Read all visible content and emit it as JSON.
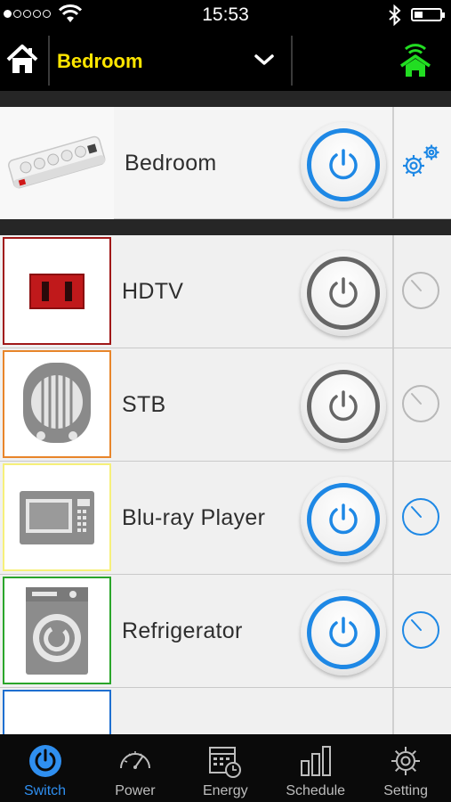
{
  "status_bar": {
    "time": "15:53",
    "signal_dots_on": 1,
    "signal_dots_total": 5,
    "icons": [
      "wifi-icon",
      "bluetooth-icon",
      "battery-icon"
    ],
    "battery_level": 0.35
  },
  "header": {
    "room": "Bedroom",
    "icons": [
      "home-icon",
      "chevron-down-icon",
      "connection-status-icon"
    ],
    "title_color": "#ffe600",
    "connection_color": "#22dd22"
  },
  "master": {
    "label": "Bedroom",
    "state": "on",
    "image": "power-strip",
    "side_icon": "settings-gears-icon"
  },
  "devices": [
    {
      "label": "HDTV",
      "state": "off",
      "frame_color": "#a01818",
      "image": "outlet-icon",
      "timer_active": false
    },
    {
      "label": "STB",
      "state": "off",
      "frame_color": "#e8852a",
      "image": "heater-icon",
      "timer_active": false
    },
    {
      "label": "Blu-ray  Player",
      "state": "on",
      "frame_color": "#f6f07a",
      "image": "microwave-icon",
      "timer_active": true
    },
    {
      "label": "Refrigerator",
      "state": "on",
      "frame_color": "#2aa52a",
      "image": "washer-icon",
      "timer_active": true
    },
    {
      "label": "",
      "state": "",
      "frame_color": "#1e6fd0",
      "image": "partial-item",
      "timer_active": false
    }
  ],
  "tabs": [
    {
      "label": "Switch",
      "icon": "power-icon",
      "active": true
    },
    {
      "label": "Power",
      "icon": "gauge-icon",
      "active": false
    },
    {
      "label": "Energy",
      "icon": "calendar-clock-icon",
      "active": false
    },
    {
      "label": "Schedule",
      "icon": "bar-chart-icon",
      "active": false
    },
    {
      "label": "Setting",
      "icon": "gear-icon",
      "active": false
    }
  ],
  "colors": {
    "accent_blue": "#1e88e5",
    "off_gray": "#666666",
    "tab_active": "#2f8ff0"
  }
}
